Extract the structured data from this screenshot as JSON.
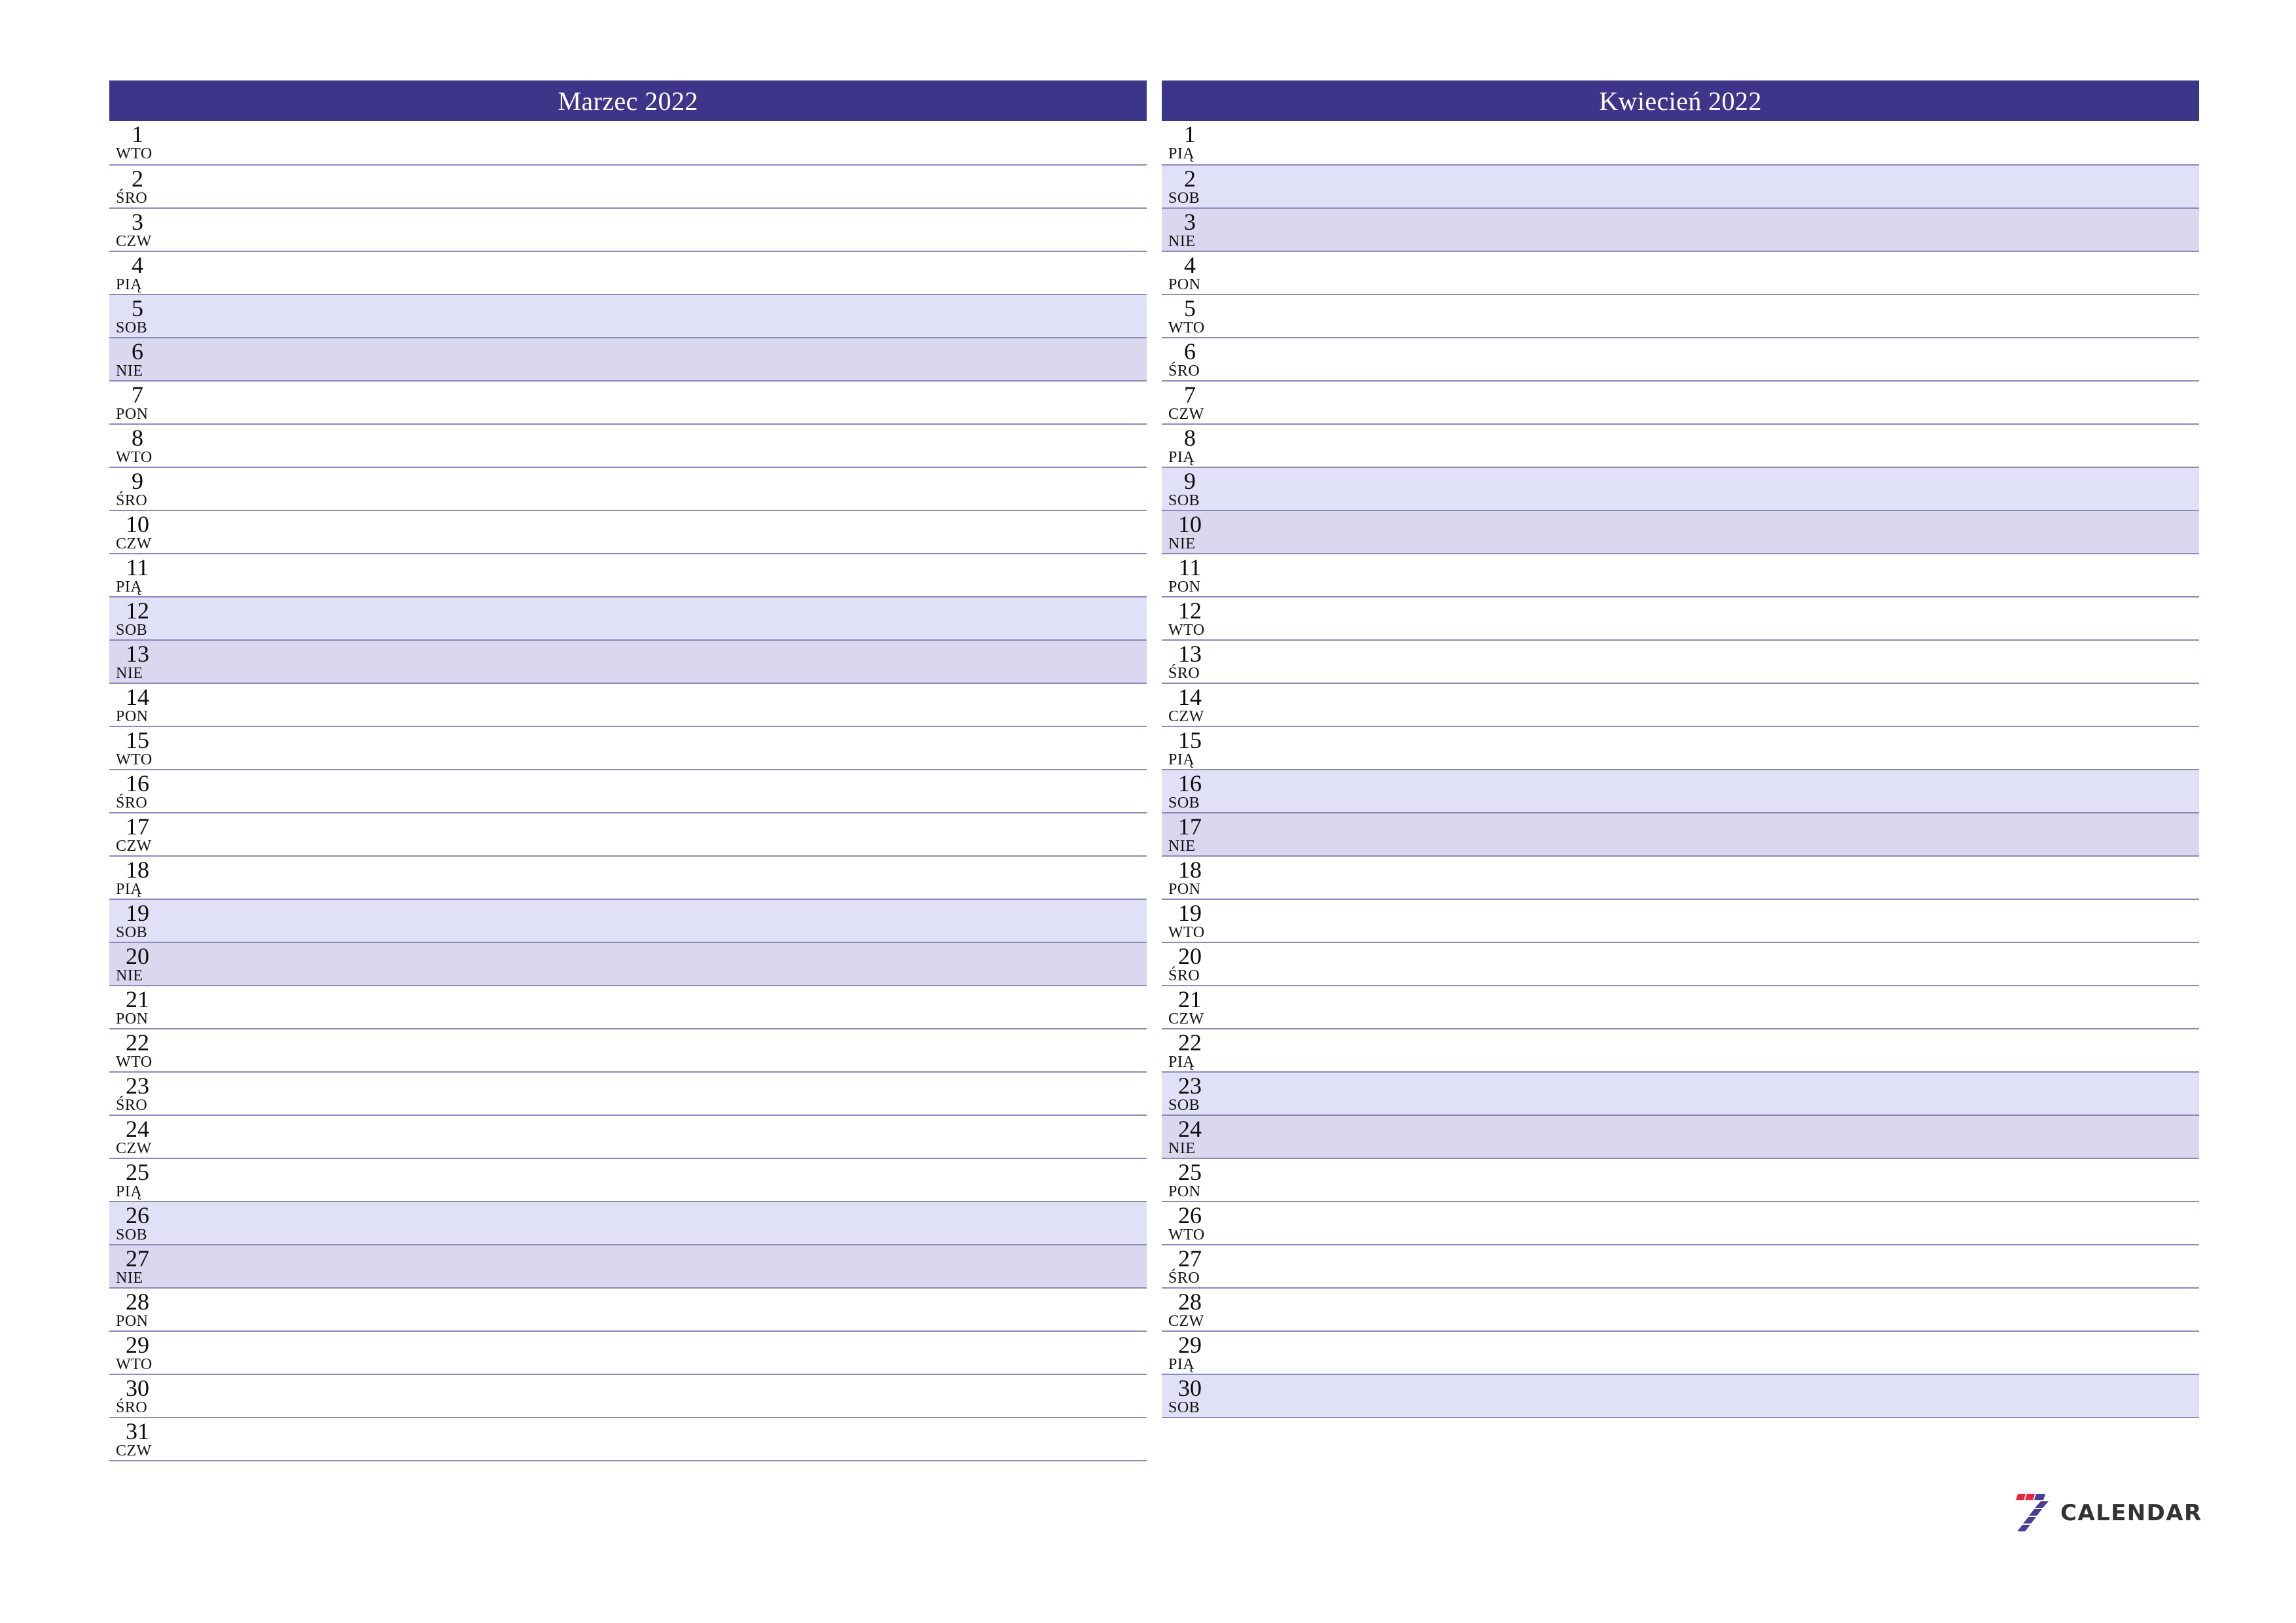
{
  "page": {
    "background": "#ffffff",
    "header_color": "#3d3589",
    "separator_color": "#8c89bb",
    "saturday_color": "#e0e1f6",
    "sunday_color": "#dbd7ee",
    "logo_red": "#f5203c",
    "logo_purple": "#4a3b9e",
    "logo_text_color": "#333333"
  },
  "months": [
    {
      "title": "Marzec 2022",
      "days": [
        {
          "num": "1",
          "abbr": "WTO",
          "kind": "weekday"
        },
        {
          "num": "2",
          "abbr": "ŚRO",
          "kind": "weekday"
        },
        {
          "num": "3",
          "abbr": "CZW",
          "kind": "weekday"
        },
        {
          "num": "4",
          "abbr": "PIĄ",
          "kind": "weekday"
        },
        {
          "num": "5",
          "abbr": "SOB",
          "kind": "sat"
        },
        {
          "num": "6",
          "abbr": "NIE",
          "kind": "sun"
        },
        {
          "num": "7",
          "abbr": "PON",
          "kind": "weekday"
        },
        {
          "num": "8",
          "abbr": "WTO",
          "kind": "weekday"
        },
        {
          "num": "9",
          "abbr": "ŚRO",
          "kind": "weekday"
        },
        {
          "num": "10",
          "abbr": "CZW",
          "kind": "weekday"
        },
        {
          "num": "11",
          "abbr": "PIĄ",
          "kind": "weekday"
        },
        {
          "num": "12",
          "abbr": "SOB",
          "kind": "sat"
        },
        {
          "num": "13",
          "abbr": "NIE",
          "kind": "sun"
        },
        {
          "num": "14",
          "abbr": "PON",
          "kind": "weekday"
        },
        {
          "num": "15",
          "abbr": "WTO",
          "kind": "weekday"
        },
        {
          "num": "16",
          "abbr": "ŚRO",
          "kind": "weekday"
        },
        {
          "num": "17",
          "abbr": "CZW",
          "kind": "weekday"
        },
        {
          "num": "18",
          "abbr": "PIĄ",
          "kind": "weekday"
        },
        {
          "num": "19",
          "abbr": "SOB",
          "kind": "sat"
        },
        {
          "num": "20",
          "abbr": "NIE",
          "kind": "sun"
        },
        {
          "num": "21",
          "abbr": "PON",
          "kind": "weekday"
        },
        {
          "num": "22",
          "abbr": "WTO",
          "kind": "weekday"
        },
        {
          "num": "23",
          "abbr": "ŚRO",
          "kind": "weekday"
        },
        {
          "num": "24",
          "abbr": "CZW",
          "kind": "weekday"
        },
        {
          "num": "25",
          "abbr": "PIĄ",
          "kind": "weekday"
        },
        {
          "num": "26",
          "abbr": "SOB",
          "kind": "sat"
        },
        {
          "num": "27",
          "abbr": "NIE",
          "kind": "sun"
        },
        {
          "num": "28",
          "abbr": "PON",
          "kind": "weekday"
        },
        {
          "num": "29",
          "abbr": "WTO",
          "kind": "weekday"
        },
        {
          "num": "30",
          "abbr": "ŚRO",
          "kind": "weekday"
        },
        {
          "num": "31",
          "abbr": "CZW",
          "kind": "weekday"
        }
      ]
    },
    {
      "title": "Kwiecień 2022",
      "days": [
        {
          "num": "1",
          "abbr": "PIĄ",
          "kind": "weekday"
        },
        {
          "num": "2",
          "abbr": "SOB",
          "kind": "sat"
        },
        {
          "num": "3",
          "abbr": "NIE",
          "kind": "sun"
        },
        {
          "num": "4",
          "abbr": "PON",
          "kind": "weekday"
        },
        {
          "num": "5",
          "abbr": "WTO",
          "kind": "weekday"
        },
        {
          "num": "6",
          "abbr": "ŚRO",
          "kind": "weekday"
        },
        {
          "num": "7",
          "abbr": "CZW",
          "kind": "weekday"
        },
        {
          "num": "8",
          "abbr": "PIĄ",
          "kind": "weekday"
        },
        {
          "num": "9",
          "abbr": "SOB",
          "kind": "sat"
        },
        {
          "num": "10",
          "abbr": "NIE",
          "kind": "sun"
        },
        {
          "num": "11",
          "abbr": "PON",
          "kind": "weekday"
        },
        {
          "num": "12",
          "abbr": "WTO",
          "kind": "weekday"
        },
        {
          "num": "13",
          "abbr": "ŚRO",
          "kind": "weekday"
        },
        {
          "num": "14",
          "abbr": "CZW",
          "kind": "weekday"
        },
        {
          "num": "15",
          "abbr": "PIĄ",
          "kind": "weekday"
        },
        {
          "num": "16",
          "abbr": "SOB",
          "kind": "sat"
        },
        {
          "num": "17",
          "abbr": "NIE",
          "kind": "sun"
        },
        {
          "num": "18",
          "abbr": "PON",
          "kind": "weekday"
        },
        {
          "num": "19",
          "abbr": "WTO",
          "kind": "weekday"
        },
        {
          "num": "20",
          "abbr": "ŚRO",
          "kind": "weekday"
        },
        {
          "num": "21",
          "abbr": "CZW",
          "kind": "weekday"
        },
        {
          "num": "22",
          "abbr": "PIĄ",
          "kind": "weekday"
        },
        {
          "num": "23",
          "abbr": "SOB",
          "kind": "sat"
        },
        {
          "num": "24",
          "abbr": "NIE",
          "kind": "sun"
        },
        {
          "num": "25",
          "abbr": "PON",
          "kind": "weekday"
        },
        {
          "num": "26",
          "abbr": "WTO",
          "kind": "weekday"
        },
        {
          "num": "27",
          "abbr": "ŚRO",
          "kind": "weekday"
        },
        {
          "num": "28",
          "abbr": "CZW",
          "kind": "weekday"
        },
        {
          "num": "29",
          "abbr": "PIĄ",
          "kind": "weekday"
        },
        {
          "num": "30",
          "abbr": "SOB",
          "kind": "sat"
        }
      ]
    }
  ],
  "logo": {
    "icon": "seven-bars-icon",
    "text": "CALENDAR"
  }
}
